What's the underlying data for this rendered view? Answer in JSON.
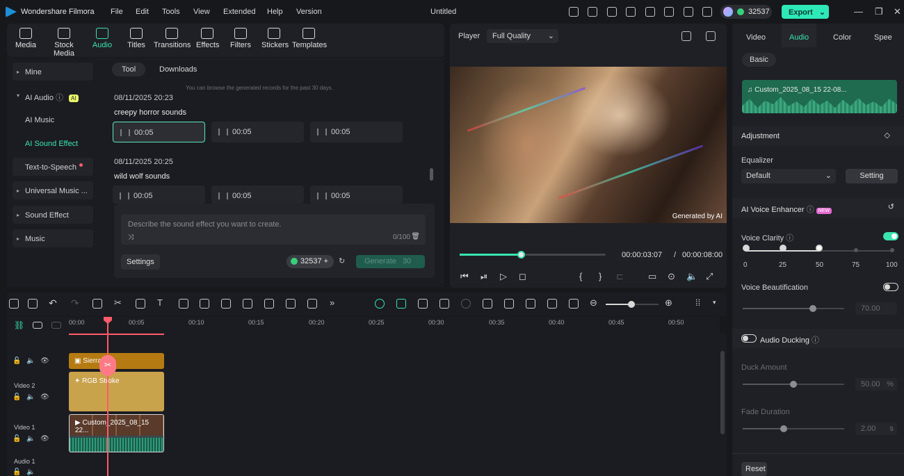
{
  "app": {
    "name": "Wondershare Filmora",
    "doc_title": "Untitled",
    "credits": "32537",
    "export_label": "Export"
  },
  "menu": [
    "File",
    "Edit",
    "Tools",
    "View",
    "Extended",
    "Help",
    "Version"
  ],
  "media_tabs": [
    {
      "label": "Media",
      "icon": "media-icon"
    },
    {
      "label": "Stock Media",
      "icon": "stock-media-icon"
    },
    {
      "label": "Audio",
      "icon": "audio-icon"
    },
    {
      "label": "Titles",
      "icon": "titles-icon"
    },
    {
      "label": "Transitions",
      "icon": "transitions-icon"
    },
    {
      "label": "Effects",
      "icon": "effects-icon"
    },
    {
      "label": "Filters",
      "icon": "filters-icon"
    },
    {
      "label": "Stickers",
      "icon": "stickers-icon"
    },
    {
      "label": "Templates",
      "icon": "templates-icon"
    }
  ],
  "sidebar": {
    "mine": "Mine",
    "ai_audio": "AI Audio",
    "ai_badge": "AI",
    "ai_music": "AI Music",
    "ai_sound_effect": "AI Sound Effect",
    "tts": "Text-to-Speech",
    "universal_music": "Universal Music ...",
    "sound_effect": "Sound Effect",
    "music": "Music"
  },
  "subtabs": {
    "tool": "Tool",
    "downloads": "Downloads"
  },
  "hint": "You can browse the generated records for the past 30 days.",
  "records": [
    {
      "date": "08/11/2025 20:23",
      "title": "creepy horror sounds",
      "clips": [
        "00:05",
        "00:05",
        "00:05"
      ]
    },
    {
      "date": "08/11/2025 20:25",
      "title": "wild wolf sounds",
      "clips": [
        "00:05",
        "00:05",
        "00:05"
      ]
    }
  ],
  "generator": {
    "placeholder": "Describe the sound effect you want to create.",
    "count": "0/100",
    "settings_label": "Settings",
    "credits": "32537",
    "generate_label": "Generate",
    "generate_cost": "30"
  },
  "player": {
    "label": "Player",
    "quality": "Full Quality",
    "watermark": "Generated by AI",
    "current_time": "00:00:03:07",
    "separator": "/",
    "total_time": "00:00:08:00",
    "progress": 0.42
  },
  "right": {
    "tabs": [
      "Video",
      "Audio",
      "Color",
      "Spee"
    ],
    "basic": "Basic",
    "clip_name": "Custom_2025_08_15 22-08...",
    "adjustment": "Adjustment",
    "equalizer": "Equalizer",
    "eq_value": "Default",
    "setting": "Setting",
    "voice_enhancer": "AI Voice Enhancer",
    "new_badge": "NEW",
    "voice_clarity": "Voice Clarity",
    "clarity_scale": [
      "0",
      "25",
      "50",
      "75",
      "100"
    ],
    "clarity_value": 50,
    "voice_beautification": "Voice Beautification",
    "beautification_value": "70.00",
    "audio_ducking": "Audio Ducking",
    "duck_amount": "Duck Amount",
    "duck_value": "50.00",
    "duck_unit": "%",
    "fade_duration": "Fade Duration",
    "fade_value": "2.00",
    "fade_unit": "s",
    "reset": "Reset"
  },
  "timeline": {
    "ruler": [
      "00:00",
      "00:05",
      "00:10",
      "00:15",
      "00:20",
      "00:25",
      "00:30",
      "00:35",
      "00:40",
      "00:45",
      "00:50"
    ],
    "tracks": {
      "video2": "Video 2",
      "video1": "Video 1",
      "audio1": "Audio 1"
    },
    "clips": {
      "title": "Sierra",
      "effect": "RGB Stroke",
      "video": "Custom_2025_08_15 22..."
    }
  },
  "colors": {
    "accent": "#3be3b0",
    "playhead": "#ff5b6a",
    "export": "#2ee8b7"
  }
}
